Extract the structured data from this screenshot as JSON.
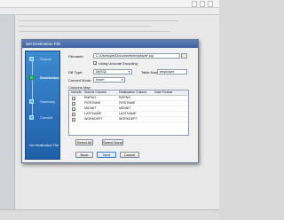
{
  "dialog": {
    "title": "Set Destination File"
  },
  "wizard": {
    "steps": [
      {
        "label": "Source"
      },
      {
        "label": "Destination"
      },
      {
        "label": "Summary"
      },
      {
        "label": "Convert"
      }
    ],
    "current_step": "Destination",
    "caption": "Set Destination File"
  },
  "form": {
    "filename_label": "Filename:",
    "filename_value": "C:\\Users\\joe\\Documents\\employee.sql",
    "unicode_label": "Using Unicode Encoding",
    "unicode_checked": true,
    "db_type_label": "DB Type:",
    "db_type_value": "MySQL",
    "table_name_label": "Table Name:",
    "table_name_value": "employee",
    "convert_mode_label": "Convert Mode:",
    "convert_mode_value": "Insert",
    "columns_map_label": "Columns Map"
  },
  "columns_map": {
    "headers": [
      "Include",
      "Source Column",
      "Destination Column",
      "Date Format"
    ],
    "rows": [
      {
        "include": true,
        "source": "EMPNO",
        "destination": "EMPNO",
        "date_format": ""
      },
      {
        "include": true,
        "source": "FIRSTNME",
        "destination": "FIRSTNME",
        "date_format": ""
      },
      {
        "include": true,
        "source": "MIDINIT",
        "destination": "MIDINIT",
        "date_format": ""
      },
      {
        "include": true,
        "source": "LASTNAME",
        "destination": "LASTNAME",
        "date_format": ""
      },
      {
        "include": true,
        "source": "WORKDEPT",
        "destination": "WORKDEPT",
        "date_format": ""
      }
    ]
  },
  "buttons": {
    "select_all": "Select All",
    "select_none": "Select None",
    "back": "Back",
    "next": "Next",
    "cancel": "Cancel"
  },
  "icons": {
    "check": "checkmark",
    "dropdown": "chevron-down",
    "browse": "folder"
  }
}
